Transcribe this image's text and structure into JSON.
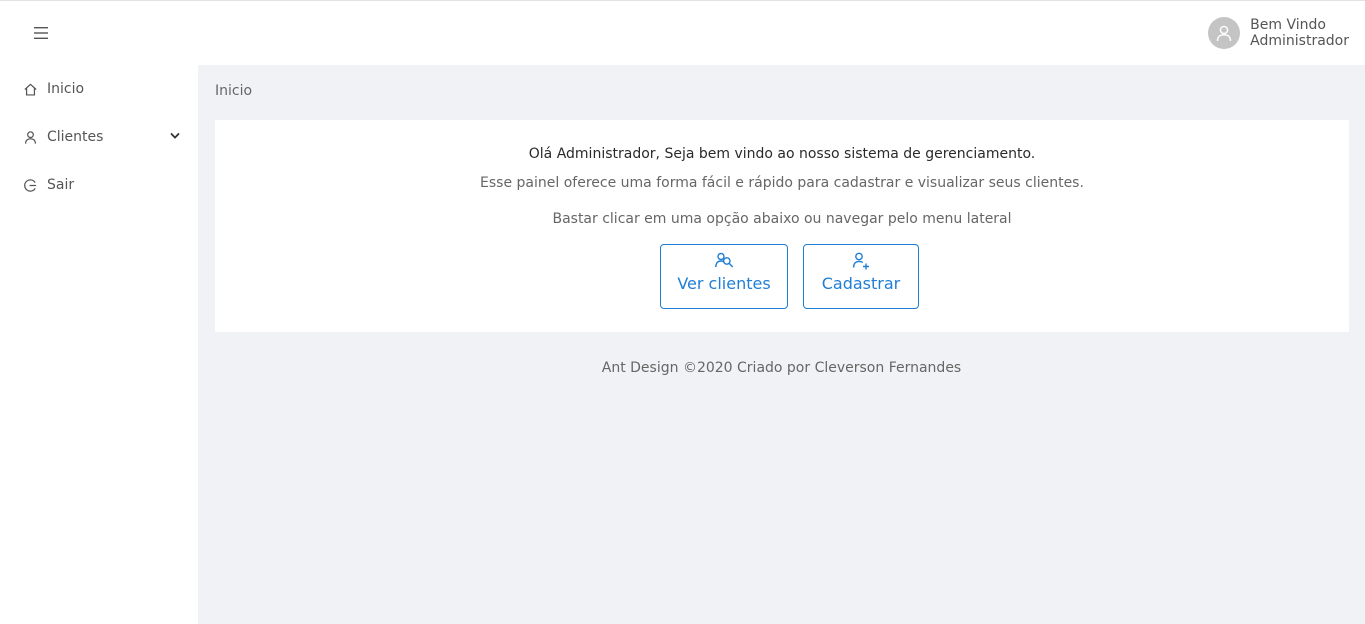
{
  "header": {
    "user_greeting": "Bem Vindo",
    "user_name": "Administrador"
  },
  "sidebar": {
    "items": [
      {
        "label": "Inicio",
        "icon": "home-icon"
      },
      {
        "label": "Clientes",
        "icon": "user-icon",
        "expandable": true
      },
      {
        "label": "Sair",
        "icon": "logout-icon"
      }
    ]
  },
  "breadcrumb": "Inicio",
  "card": {
    "welcome": "Olá Administrador, Seja bem vindo ao nosso sistema de gerenciamento.",
    "description": "Esse painel oferece uma forma fácil e rápido para cadastrar e visualizar seus clientes.",
    "hint": "Bastar clicar em uma opção abaixo ou navegar pelo menu lateral",
    "buttons": {
      "view_label": "Ver clientes",
      "register_label": "Cadastrar"
    }
  },
  "footer": "Ant Design ©2020 Criado por Cleverson Fernandes",
  "colors": {
    "accent": "#1f7ed6",
    "background": "#f0f2f5"
  }
}
